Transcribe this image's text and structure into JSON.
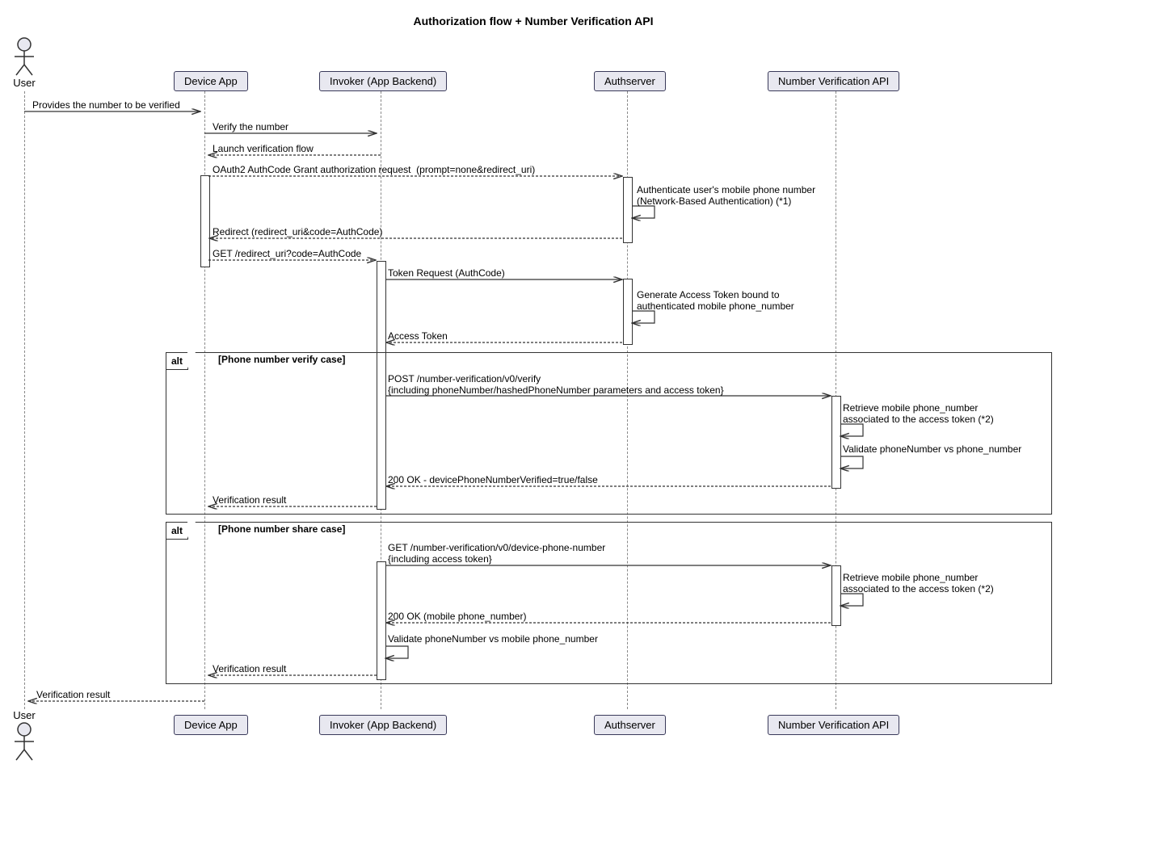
{
  "title": "Authorization flow + Number Verification API",
  "participants": {
    "user": "User",
    "deviceApp": "Device App",
    "invoker": "Invoker (App Backend)",
    "authserver": "Authserver",
    "nvapi": "Number Verification API"
  },
  "messages": {
    "m1": "Provides the number to be verified",
    "m2": "Verify the number",
    "m3": "Launch verification flow",
    "m4": "OAuth2 AuthCode Grant authorization request  (prompt=none&redirect_uri)",
    "m5": "Authenticate user's mobile phone number\n(Network-Based Authentication) (*1)",
    "m6": "Redirect (redirect_uri&code=AuthCode)",
    "m7": "GET /redirect_uri?code=AuthCode",
    "m8": "Token Request (AuthCode)",
    "m9": "Generate Access Token bound to\nauthenticated mobile phone_number",
    "m10": "Access Token",
    "m11": "POST /number-verification/v0/verify\n{including phoneNumber/hashedPhoneNumber parameters and access token}",
    "m12": "Retrieve mobile phone_number\nassociated to the access token (*2)",
    "m13": "Validate phoneNumber vs phone_number",
    "m14": "200 OK - devicePhoneNumberVerified=true/false",
    "m15": "Verification result",
    "m16": "GET /number-verification/v0/device-phone-number\n{including access token}",
    "m17": "Retrieve mobile phone_number\nassociated to the access token (*2)",
    "m18": "200 OK (mobile phone_number)",
    "m19": "Validate phoneNumber vs mobile phone_number",
    "m20": "Verification result",
    "m21": "Verification result"
  },
  "frames": {
    "alt": "alt",
    "verifyCase": "[Phone number verify case]",
    "shareCase": "[Phone number share case]"
  }
}
